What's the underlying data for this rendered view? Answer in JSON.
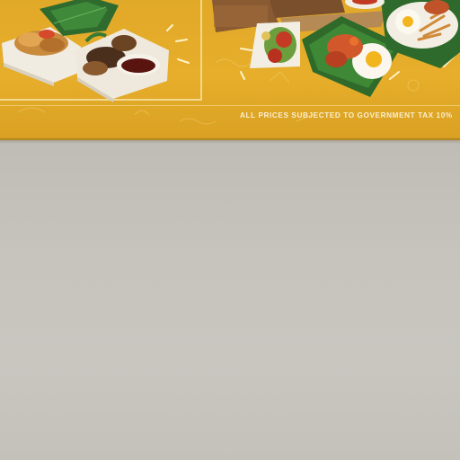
{
  "banner": {
    "tax_notice": "ALL PRICES SUBJECTED TO GOVERNMENT TAX 10%"
  },
  "colors": {
    "banner_yellow": "#e3aa28",
    "wall_gray": "#c6c3bd",
    "notice_text": "#fbeed0"
  }
}
